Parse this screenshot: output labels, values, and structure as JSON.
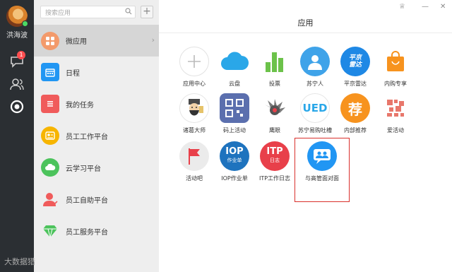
{
  "user": {
    "name": "洪海波"
  },
  "rail": {
    "badge": "1",
    "icons": [
      "chat-icon",
      "contacts-icon",
      "apps-icon"
    ]
  },
  "search": {
    "placeholder": "搜索应用"
  },
  "add_label": "+",
  "menu": [
    {
      "label": "微应用",
      "icon": "grid-icon",
      "color": "#f39a6b",
      "active": true
    },
    {
      "label": "日程",
      "icon": "calendar-icon",
      "color": "#2196f3"
    },
    {
      "label": "我的任务",
      "icon": "task-icon",
      "color": "#f05b5b"
    },
    {
      "label": "员工工作平台",
      "icon": "id-card-icon",
      "color": "#f7b500"
    },
    {
      "label": "云学习平台",
      "icon": "cloud-icon",
      "color": "#4cc35c"
    },
    {
      "label": "员工自助平台",
      "icon": "person-icon",
      "color": "#f05b5b"
    },
    {
      "label": "员工服务平台",
      "icon": "diamond-icon",
      "color": "#4cc35c"
    }
  ],
  "main": {
    "title": "应用"
  },
  "apps": [
    {
      "label": "应用中心",
      "icon": "plus-icon",
      "color": "#ffffff"
    },
    {
      "label": "云盘",
      "icon": "cloud-icon",
      "color": "#2aa7e8"
    },
    {
      "label": "投票",
      "icon": "bar-chart-icon",
      "color": "#ffffff"
    },
    {
      "label": "苏宁人",
      "icon": "person-icon",
      "color": "#3fa3e9"
    },
    {
      "label": "平京雷达",
      "icon": "logo-icon",
      "color": "#1e88e5",
      "text": "平京雷达"
    },
    {
      "label": "内购专享",
      "icon": "shopping-bag-icon",
      "color": "#ffffff"
    },
    {
      "label": "诸葛大师",
      "icon": "sage-icon",
      "color": "#ffffff"
    },
    {
      "label": "码上活动",
      "icon": "qr-icon",
      "color": "#5b6fae"
    },
    {
      "label": "鹰眼",
      "icon": "eagle-icon",
      "color": "#ffffff"
    },
    {
      "label": "苏宁易购吐槽",
      "icon": "ued-icon",
      "color": "#ffffff",
      "text": "UED"
    },
    {
      "label": "内部推荐",
      "icon": "recommend-icon",
      "color": "#f7931e",
      "text": "荐"
    },
    {
      "label": "爱活动",
      "icon": "pattern-icon",
      "color": "#ffffff"
    },
    {
      "label": "活动吧",
      "icon": "flag-icon",
      "color": "#e8e8e8"
    },
    {
      "label": "IOP作业单",
      "icon": "iop-icon",
      "color": "#1e73be",
      "text": "IOP",
      "sub": "作业单"
    },
    {
      "label": "ITP工作日志",
      "icon": "itp-icon",
      "color": "#e8404a",
      "text": "ITP",
      "sub": "日志"
    },
    {
      "label": "与高管面对面",
      "icon": "chat-people-icon",
      "color": "#2196f3"
    }
  ],
  "watermark": "大数据猎"
}
